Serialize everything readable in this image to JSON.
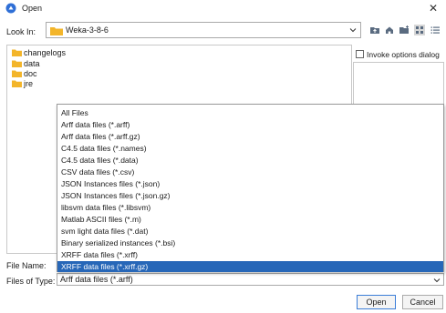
{
  "window": {
    "title": "Open"
  },
  "look_in": {
    "label": "Look In:",
    "value": "Weka-3-8-6"
  },
  "toolbar": {
    "icons": [
      "up-folder-icon",
      "home-icon",
      "new-folder-icon",
      "list-view-icon",
      "details-view-icon"
    ]
  },
  "files": [
    {
      "name": "changelogs"
    },
    {
      "name": "data"
    },
    {
      "name": "doc"
    },
    {
      "name": "jre"
    }
  ],
  "options": {
    "invoke_label": "Invoke options dialog",
    "invoke_checked": false
  },
  "file_name": {
    "label": "File Name:",
    "value": ""
  },
  "file_type": {
    "label": "Files of Type:",
    "value": "Arff data files (*.arff)",
    "options": [
      "All Files",
      "Arff data files (*.arff)",
      "Arff data files (*.arff.gz)",
      "C4.5 data files (*.names)",
      "C4.5 data files (*.data)",
      "CSV data files (*.csv)",
      "JSON Instances files (*.json)",
      "JSON Instances files (*.json.gz)",
      "libsvm data files (*.libsvm)",
      "Matlab ASCII files (*.m)",
      "svm light data files (*.dat)",
      "Binary serialized instances (*.bsi)",
      "XRFF data files (*.xrff)",
      "XRFF data files (*.xrff.gz)"
    ],
    "highlighted": "XRFF data files (*.xrff.gz)"
  },
  "buttons": {
    "open": "Open",
    "cancel": "Cancel"
  },
  "colors": {
    "accent": "#2767b8",
    "folder": "#f3b52a",
    "app_icon": "#2f6fd6"
  }
}
